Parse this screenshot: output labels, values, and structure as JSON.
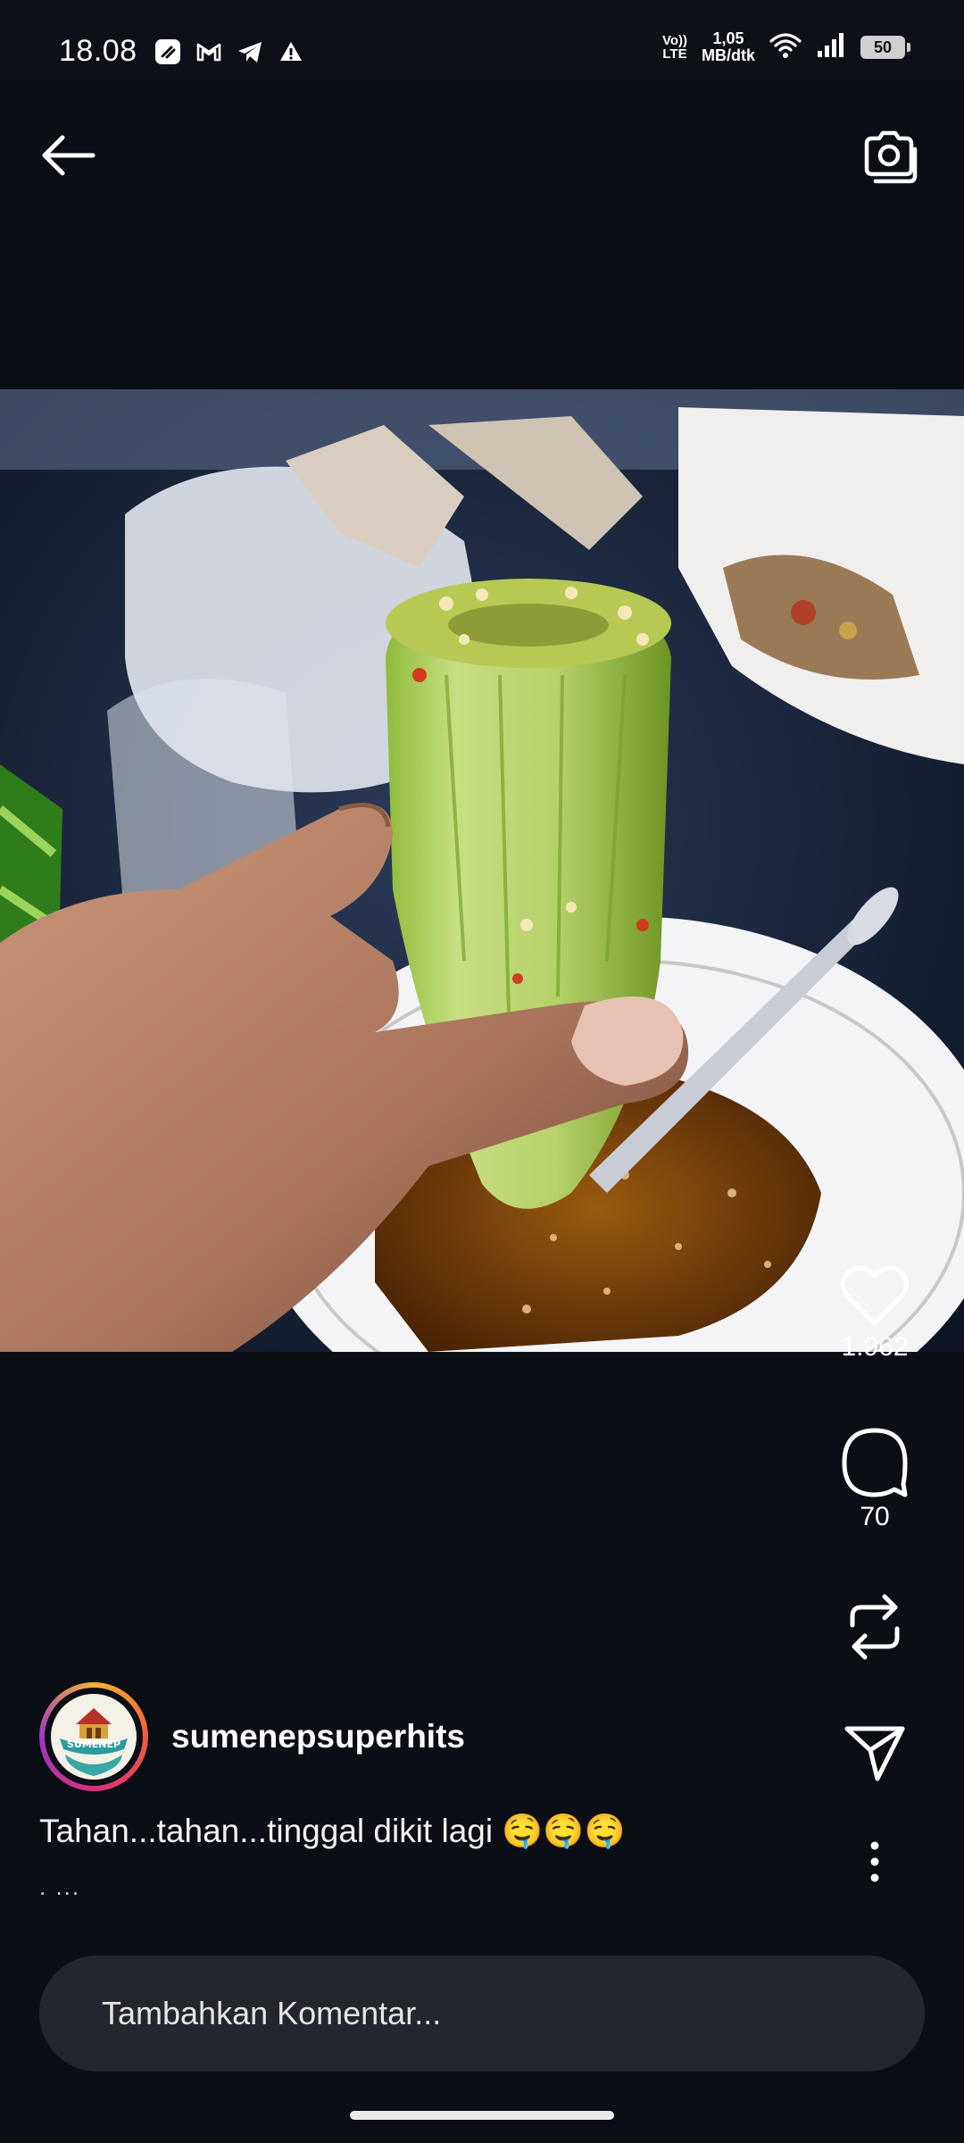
{
  "status_bar": {
    "time": "18.08",
    "network_label_1": "Vo))",
    "network_label_2": "LTE",
    "speed_value": "1,05",
    "speed_unit": "MB/dtk",
    "battery": "50",
    "left_icons": [
      "speedometer-app-icon",
      "gmail-icon",
      "telegram-icon",
      "warning-icon"
    ],
    "right_icons": [
      "volte-icon",
      "wifi-icon",
      "signal-icon",
      "battery-icon"
    ]
  },
  "header": {
    "back_icon": "arrow-left-icon",
    "camera_icon": "camera-icon"
  },
  "post": {
    "image_description_icon": "post-photo",
    "likes": "1.962",
    "comments": "70",
    "author": {
      "username": "sumenepsuperhits",
      "avatar_text": "SUMENEP"
    },
    "caption": "Tahan...tahan...tinggal dikit lagi 🤤🤤🤤",
    "caption_more": ". ..."
  },
  "actions": {
    "like_icon": "heart-icon",
    "comment_icon": "comment-icon",
    "repost_icon": "repost-icon",
    "share_icon": "send-icon",
    "more_icon": "more-vertical-icon"
  },
  "comment": {
    "placeholder": "Tambahkan Komentar..."
  },
  "colors": {
    "background": "#0b0e14",
    "input_background": "#23262d",
    "text": "#ffffff"
  }
}
